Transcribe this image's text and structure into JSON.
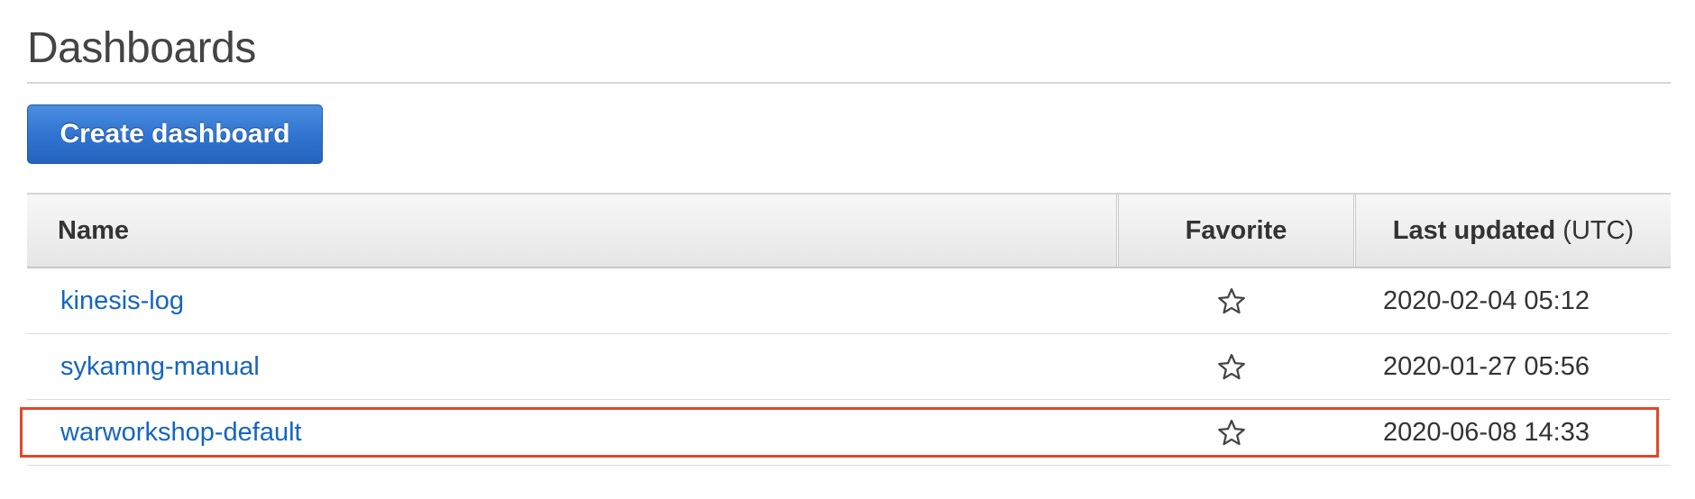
{
  "page": {
    "title": "Dashboards",
    "create_button_label": "Create dashboard"
  },
  "table": {
    "headers": {
      "name": "Name",
      "favorite": "Favorite",
      "last_updated": "Last updated",
      "last_updated_suffix": "(UTC)"
    },
    "rows": [
      {
        "name": "kinesis-log",
        "favorite": false,
        "favorite_icon": "star-outline-icon",
        "last_updated": "2020-02-04 05:12"
      },
      {
        "name": "sykamng-manual",
        "favorite": false,
        "favorite_icon": "star-outline-icon",
        "last_updated": "2020-01-27 05:56"
      },
      {
        "name": "warworkshop-default",
        "favorite": false,
        "favorite_icon": "star-outline-icon",
        "last_updated": "2020-06-08 14:33"
      }
    ]
  },
  "colors": {
    "link": "#1565c0",
    "button": "#2f73d0",
    "highlight": "#e0482a"
  }
}
